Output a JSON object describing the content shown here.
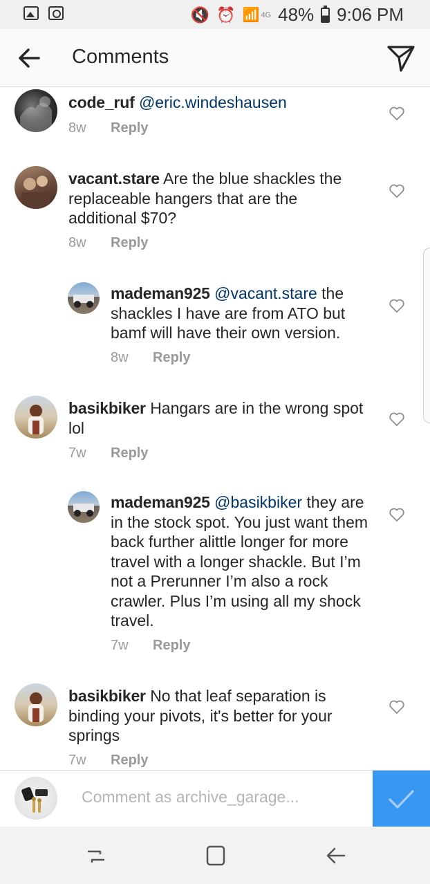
{
  "status_bar": {
    "network": "4G",
    "battery": "48%",
    "time": "9:06 PM"
  },
  "header": {
    "title": "Comments"
  },
  "comments": [
    {
      "username": "code_ruf",
      "mention": "@eric.windeshausen",
      "text": "",
      "age": "8w",
      "reply_label": "Reply"
    },
    {
      "username": "vacant.stare",
      "mention": "",
      "text": "Are the blue shackles the replaceable hangers that are the additional $70?",
      "age": "8w",
      "reply_label": "Reply"
    },
    {
      "username": "mademan925",
      "mention": "@vacant.stare",
      "text": "the shackles I have are from ATO but bamf will have their own version.",
      "age": "8w",
      "reply_label": "Reply"
    },
    {
      "username": "basikbiker",
      "mention": "",
      "text": "Hangars are in the wrong spot lol",
      "age": "7w",
      "reply_label": "Reply"
    },
    {
      "username": "mademan925",
      "mention": "@basikbiker",
      "text": "they are in the stock spot. You just want them back further alittle longer for more travel with a longer shackle. But I’m not a Prerunner I’m also a rock crawler. Plus I’m using all my shock travel.",
      "age": "7w",
      "reply_label": "Reply"
    },
    {
      "username": "basikbiker",
      "mention": "",
      "text": "No that leaf separation is binding your pivots, it's better for your springs",
      "age": "7w",
      "reply_label": "Reply"
    }
  ],
  "comment_box": {
    "placeholder": "Comment as archive_garage..."
  },
  "colors": {
    "accent": "#3897f0",
    "mention": "#003569",
    "meta": "#999999"
  }
}
